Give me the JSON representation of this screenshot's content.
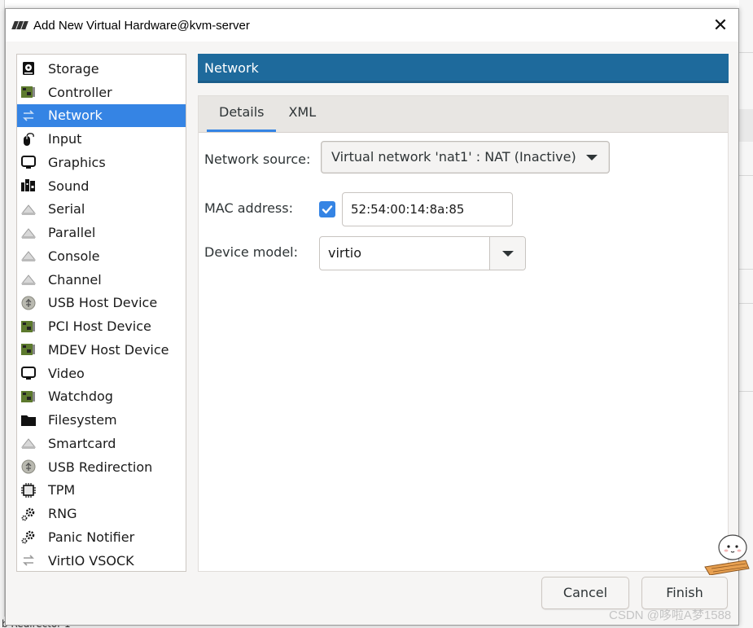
{
  "window": {
    "title": "Add New Virtual Hardware@kvm-server",
    "close_glyph": "✕"
  },
  "background": {
    "bottom_text": "b Redirector 1"
  },
  "devices": [
    {
      "label": "Storage",
      "icon": "storage-icon"
    },
    {
      "label": "Controller",
      "icon": "controller-icon"
    },
    {
      "label": "Network",
      "icon": "network-icon",
      "selected": true
    },
    {
      "label": "Input",
      "icon": "mouse-icon"
    },
    {
      "label": "Graphics",
      "icon": "monitor-icon"
    },
    {
      "label": "Sound",
      "icon": "sound-icon"
    },
    {
      "label": "Serial",
      "icon": "serial-icon"
    },
    {
      "label": "Parallel",
      "icon": "parallel-icon"
    },
    {
      "label": "Console",
      "icon": "console-icon"
    },
    {
      "label": "Channel",
      "icon": "channel-icon"
    },
    {
      "label": "USB Host Device",
      "icon": "usb-icon"
    },
    {
      "label": "PCI Host Device",
      "icon": "pci-icon"
    },
    {
      "label": "MDEV Host Device",
      "icon": "mdev-icon"
    },
    {
      "label": "Video",
      "icon": "video-icon"
    },
    {
      "label": "Watchdog",
      "icon": "watchdog-icon"
    },
    {
      "label": "Filesystem",
      "icon": "folder-icon"
    },
    {
      "label": "Smartcard",
      "icon": "smartcard-icon"
    },
    {
      "label": "USB Redirection",
      "icon": "usb-redirection-icon"
    },
    {
      "label": "TPM",
      "icon": "chip-icon"
    },
    {
      "label": "RNG",
      "icon": "rng-icon"
    },
    {
      "label": "Panic Notifier",
      "icon": "panic-notifier-icon"
    },
    {
      "label": "VirtIO VSOCK",
      "icon": "vsock-icon"
    }
  ],
  "page": {
    "header": "Network",
    "tabs": [
      {
        "label": "Details",
        "active": true
      },
      {
        "label": "XML",
        "active": false
      }
    ],
    "network_source_label": "Network source:",
    "network_source_value": "Virtual network 'nat1' : NAT (Inactive)",
    "mac_label": "MAC address:",
    "mac_checked": true,
    "mac_value": "52:54:00:14:8a:85",
    "device_model_label": "Device model:",
    "device_model_value": "virtio"
  },
  "buttons": {
    "cancel": "Cancel",
    "finish": "Finish"
  },
  "watermark": "CSDN @哆啦A梦1588",
  "colors": {
    "selection": "#3584e4",
    "header_bg": "#1e6a9c",
    "checkbox": "#3584e4"
  }
}
